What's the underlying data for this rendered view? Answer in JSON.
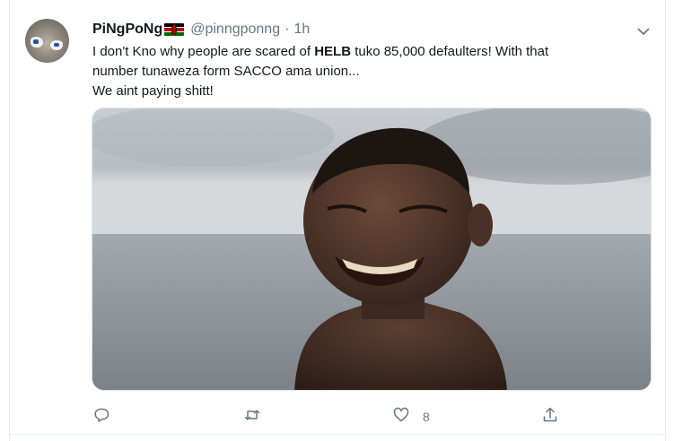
{
  "tweet": {
    "display_name": "PiNgPoNg",
    "handle": "@pinngponng",
    "separator": "·",
    "time": "1h",
    "text_line1_pre": "I don't Kno why people are scared of ",
    "text_line1_bold": "HELB",
    "text_line1_post": " tuko 85,000 defaulters! With that",
    "text_line2": "number tunaweza form SACCO ama union...",
    "text_line3": "We aint paying shitt!"
  },
  "actions": {
    "reply_count": "",
    "retweet_count": "",
    "like_count": "8"
  },
  "icons": {
    "flag": "kenya-flag-emoji",
    "menu": "chevron-down-icon",
    "reply": "reply-icon",
    "retweet": "retweet-icon",
    "like": "heart-icon",
    "share": "share-icon"
  },
  "colors": {
    "text": "#14171a",
    "secondary": "#657786",
    "border": "#e6ecf0"
  }
}
